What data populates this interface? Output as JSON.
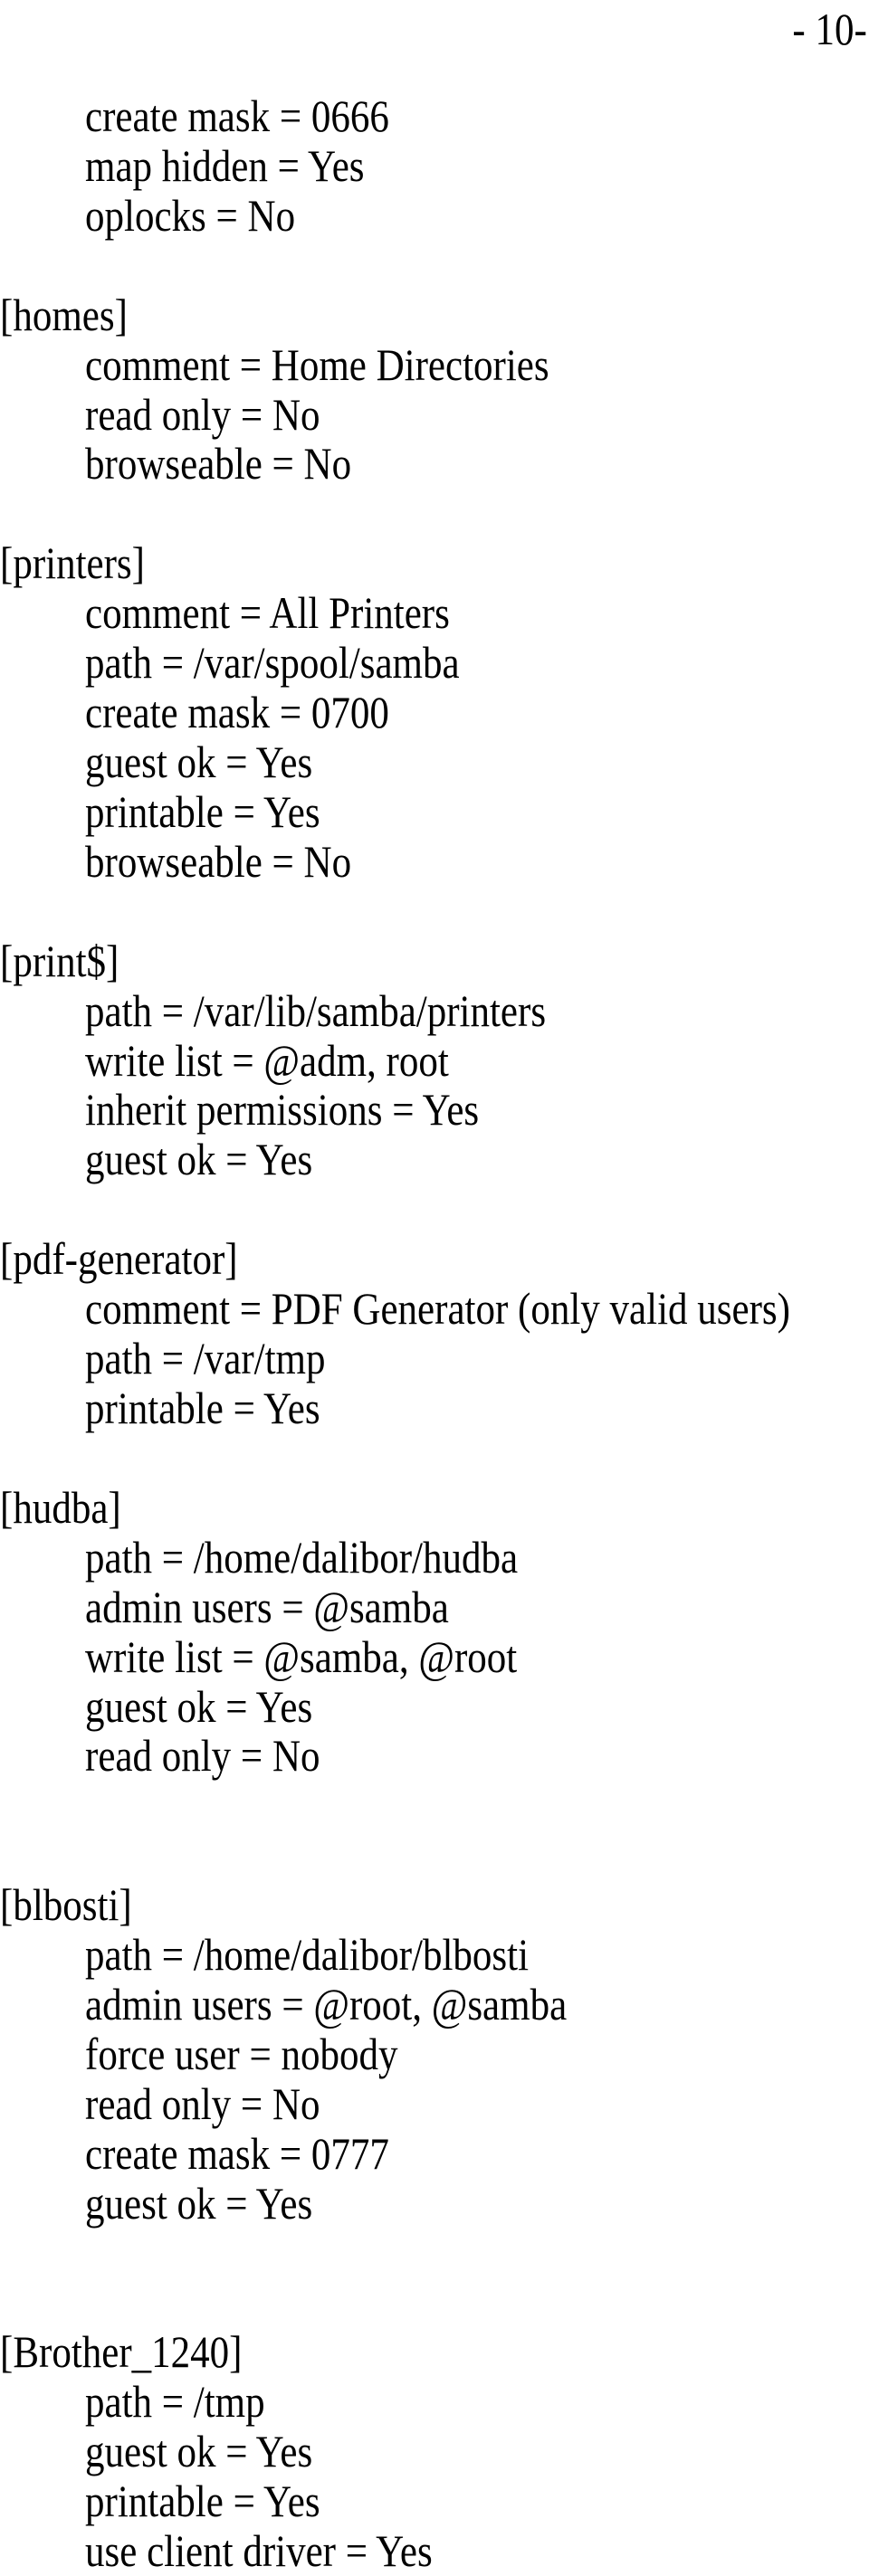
{
  "page_number": "- 10-",
  "document": {
    "leading_settings": [
      "create mask = 0666",
      "map hidden = Yes",
      "oplocks = No"
    ],
    "sections": [
      {
        "header": "[homes]",
        "gap_before": 1,
        "settings": [
          "comment = Home Directories",
          "read only = No",
          "browseable = No"
        ]
      },
      {
        "header": "[printers]",
        "gap_before": 1,
        "settings": [
          "comment = All Printers",
          "path = /var/spool/samba",
          "create mask = 0700",
          "guest ok = Yes",
          "printable = Yes",
          "browseable = No"
        ]
      },
      {
        "header": "[print$]",
        "gap_before": 1,
        "settings": [
          "path = /var/lib/samba/printers",
          "write list = @adm, root",
          "inherit permissions = Yes",
          "guest ok = Yes"
        ]
      },
      {
        "header": "[pdf-generator]",
        "gap_before": 1,
        "settings": [
          "comment = PDF Generator (only valid users)",
          "path = /var/tmp",
          "printable = Yes"
        ]
      },
      {
        "header": "[hudba]",
        "gap_before": 1,
        "settings": [
          "path = /home/dalibor/hudba",
          "admin users = @samba",
          "write list = @samba, @root",
          "guest ok = Yes",
          "read only = No"
        ]
      },
      {
        "header": "[blbosti]",
        "gap_before": 2,
        "settings": [
          "path = /home/dalibor/blbosti",
          "admin users = @root, @samba",
          "force user = nobody",
          "read only = No",
          "create mask = 0777",
          "guest ok = Yes"
        ]
      },
      {
        "header": "[Brother_1240]",
        "gap_before": 2,
        "settings": [
          "path = /tmp",
          "guest ok = Yes",
          "printable = Yes",
          "use client driver = Yes"
        ]
      }
    ]
  }
}
